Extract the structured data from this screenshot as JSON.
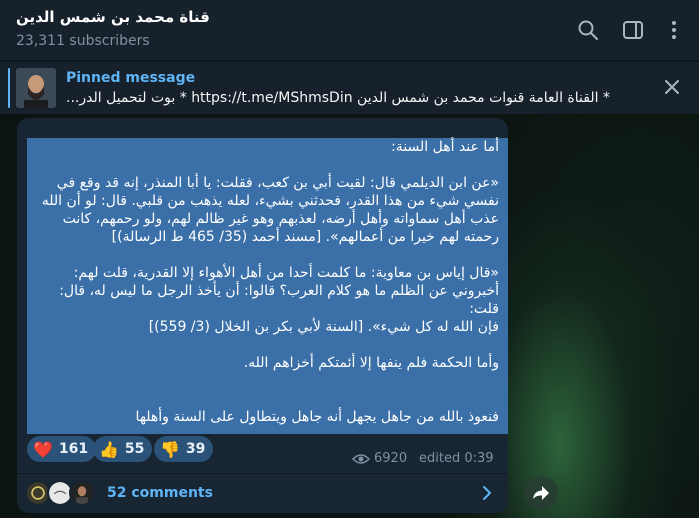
{
  "header": {
    "title": "قناة محمد بن شمس الدين",
    "subscribers": "23,311 subscribers"
  },
  "pinned": {
    "label": "Pinned message",
    "text": "* القناة العامة  قنوات محمد بن شمس الدين https://t.me/MShmsDin * بوت لتحميل الدر..."
  },
  "message": {
    "lines": [
      "أما عند أهل السنة:",
      "",
      "«عن ابن الديلمي قال: لقيت أبي بن كعب، فقلت: يا أبا المنذر، إنه قد وقع في",
      "نفسي شيء من هذا القدر، فحدثني بشيء، لعله يذهب من قلبي. قال: لو أن الله",
      "عذب أهل سماواته وأهل أرضه، لعذبهم وهو غير ظالم لهم، ولو رحمهم، كانت",
      "رحمته لهم خيرا من أعمالهم». [مسند أحمد (35/ 465 ط الرسالة)]",
      "",
      "«قال إياس بن معاوية: ما كلمت أحدا من أهل الأهواء إلا القدرية، قلت لهم:",
      "أخبروني عن الظلم ما هو كلام العرب؟ قالوا: أن يأخذ الرجل ما ليس له، قال: قلت:",
      "فإن الله له كل شيء». [السنة لأبي بكر بن الخلال (3/ 559)]",
      "",
      "وأما الحكمة فلم ينفها إلا أئمتكم أخزاهم الله.",
      "",
      "",
      "فنعوذ بالله من جاهل يجهل أنه جاهل ويتطاول على السنة وأهلها"
    ],
    "reactions": [
      {
        "emoji": "❤️",
        "count": "161"
      },
      {
        "emoji": "👍",
        "count": "55"
      },
      {
        "emoji": "👎",
        "count": "39"
      }
    ],
    "views": "6920",
    "edited": "edited 0:39",
    "comments": "52 comments"
  },
  "colors": {
    "accent": "#5eb5f7",
    "selection": "#3a6fa8",
    "bubble": "#182533",
    "header": "#17212b"
  }
}
